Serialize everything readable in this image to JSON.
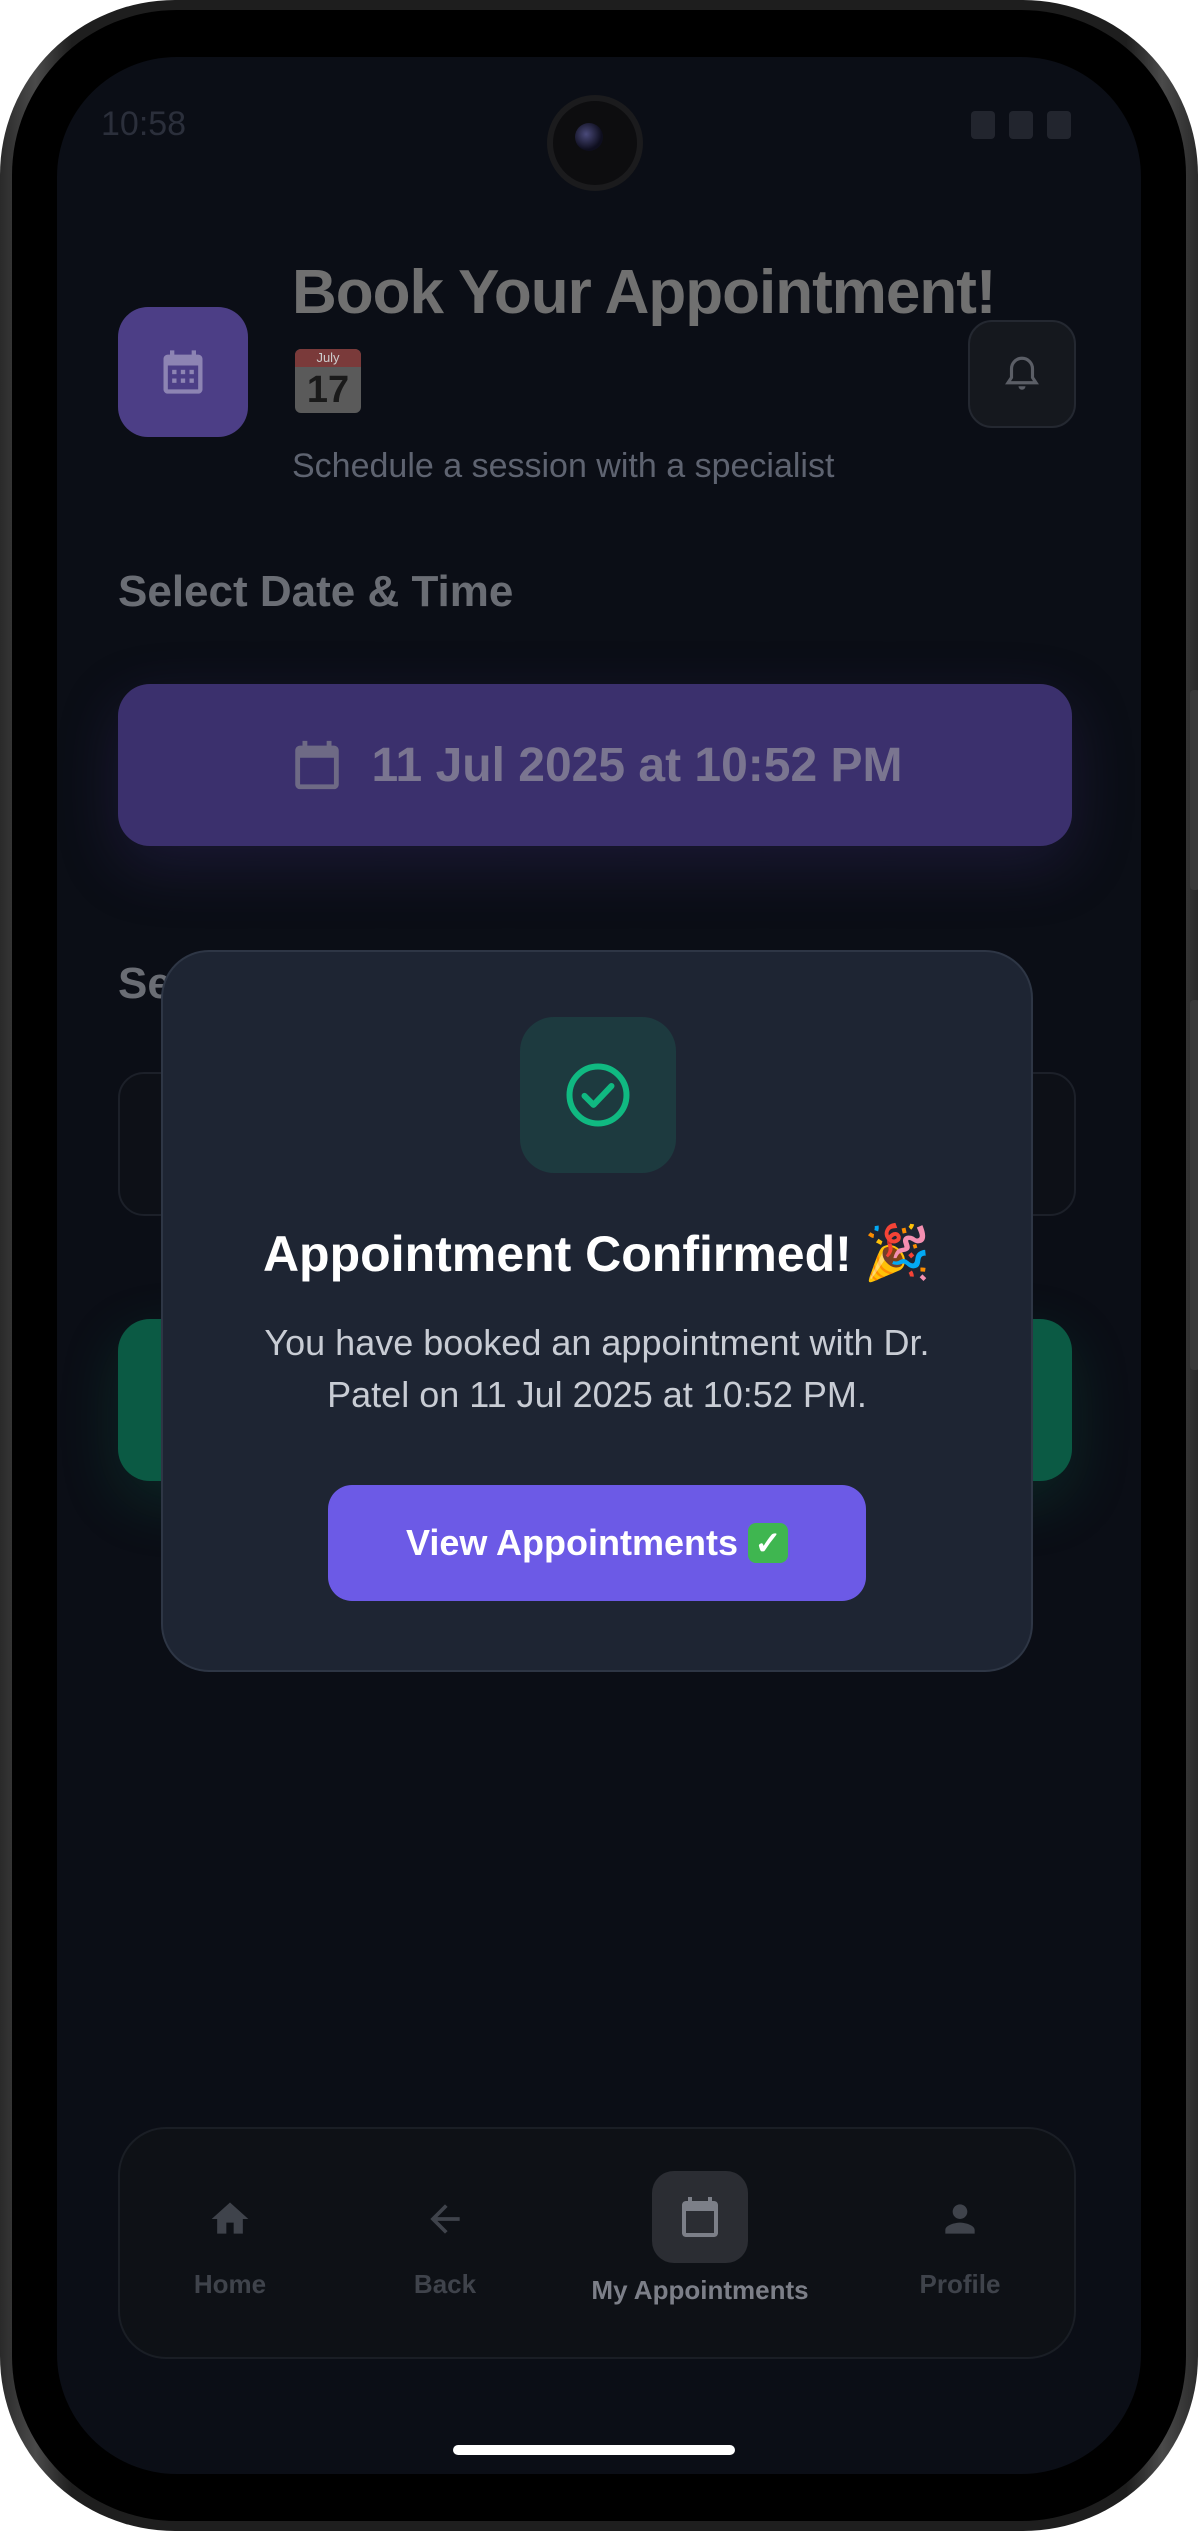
{
  "status_bar": {
    "time": "10:58"
  },
  "header": {
    "title": "Book Your Appointment!",
    "calendar_emoji": {
      "month": "July",
      "day": "17"
    },
    "subtitle": "Schedule a session with a specialist"
  },
  "date_section": {
    "label": "Select Date & Time",
    "selected": "11 Jul 2025 at 10:52 PM"
  },
  "specialist_section": {
    "label_partial": "Se"
  },
  "modal": {
    "title": "Appointment Confirmed!",
    "title_emoji": "🎉",
    "message": "You have booked an appointment with Dr. Patel on 11 Jul 2025 at 10:52 PM.",
    "button_label": "View Appointments",
    "button_emoji": "✅"
  },
  "bottom_nav": {
    "items": [
      {
        "label": "Home",
        "icon": "home-icon"
      },
      {
        "label": "Back",
        "icon": "arrow-left-icon"
      },
      {
        "label": "My Appointments",
        "icon": "calendar-icon",
        "active": true
      },
      {
        "label": "Profile",
        "icon": "person-icon"
      }
    ]
  },
  "colors": {
    "accent": "#6c5ae6",
    "success": "#10b981",
    "background": "#0b0e16",
    "modal_bg": "#1e2533"
  }
}
